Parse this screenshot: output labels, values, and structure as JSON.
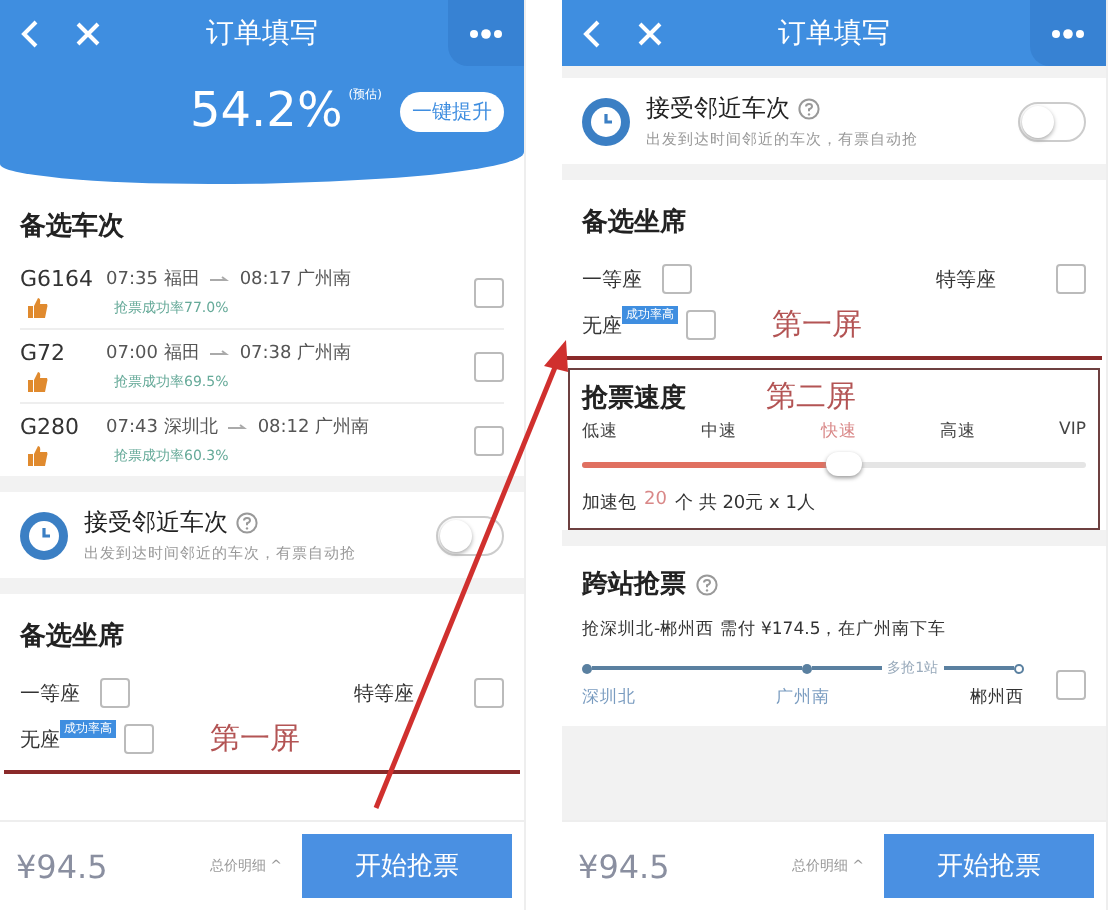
{
  "left_screen": {
    "title": "订单填写",
    "rate": "54.2%",
    "rate_note": "(预估)",
    "boost_button": "一键提升",
    "trains_heading": "备选车次",
    "trains": [
      {
        "number": "G6164",
        "depart": "07:35 福田",
        "arrive": "08:17 广州南",
        "rate": "抢票成功率77.0%",
        "checked": false
      },
      {
        "number": "G72",
        "depart": "07:00 福田",
        "arrive": "07:38 广州南",
        "rate": "抢票成功率69.5%",
        "checked": false
      },
      {
        "number": "G280",
        "depart": "07:43 深圳北",
        "arrive": "08:12 广州南",
        "rate": "抢票成功率60.3%",
        "checked": false
      }
    ],
    "nearby": {
      "title": "接受邻近车次",
      "subtitle": "出发到达时间邻近的车次，有票自动抢",
      "on": false
    },
    "seats_heading": "备选坐席",
    "seats": [
      {
        "label": "一等座",
        "checked": false
      },
      {
        "label": "特等座",
        "checked": false
      },
      {
        "label": "无座",
        "badge": "成功率高",
        "checked": false
      }
    ],
    "annotation": "第一屏",
    "footer": {
      "price": "¥94.5",
      "detail": "总价明细 ^",
      "submit": "开始抢票"
    }
  },
  "right_screen": {
    "title": "订单填写",
    "nearby": {
      "title": "接受邻近车次",
      "subtitle": "出发到达时间邻近的车次，有票自动抢",
      "on": false
    },
    "seats_heading": "备选坐席",
    "seats": [
      {
        "label": "一等座",
        "checked": false
      },
      {
        "label": "特等座",
        "checked": false
      },
      {
        "label": "无座",
        "badge": "成功率高",
        "checked": false
      }
    ],
    "annotation": "第一屏",
    "speed": {
      "heading": "抢票速度",
      "annotation": "第二屏",
      "level": 0.52,
      "options": [
        {
          "label": "低速",
          "selected": false
        },
        {
          "label": "中速",
          "selected": false
        },
        {
          "label": "快速",
          "selected": true
        },
        {
          "label": "高速",
          "selected": false
        },
        {
          "label": "VIP",
          "selected": false
        }
      ],
      "pack_label": "加速包",
      "pack_count": "20",
      "pack_text": "个 共 20元 x 1人"
    },
    "cross": {
      "heading": "跨站抢票",
      "summary": "抢深圳北-郴州西 需付 ¥174.5，在广州南下车",
      "extra": "多抢1站",
      "checked": false,
      "stations": [
        "深圳北",
        "广州南",
        "郴州西"
      ]
    },
    "footer": {
      "price": "¥94.5",
      "detail": "总价明细 ^",
      "submit": "开始抢票"
    }
  }
}
